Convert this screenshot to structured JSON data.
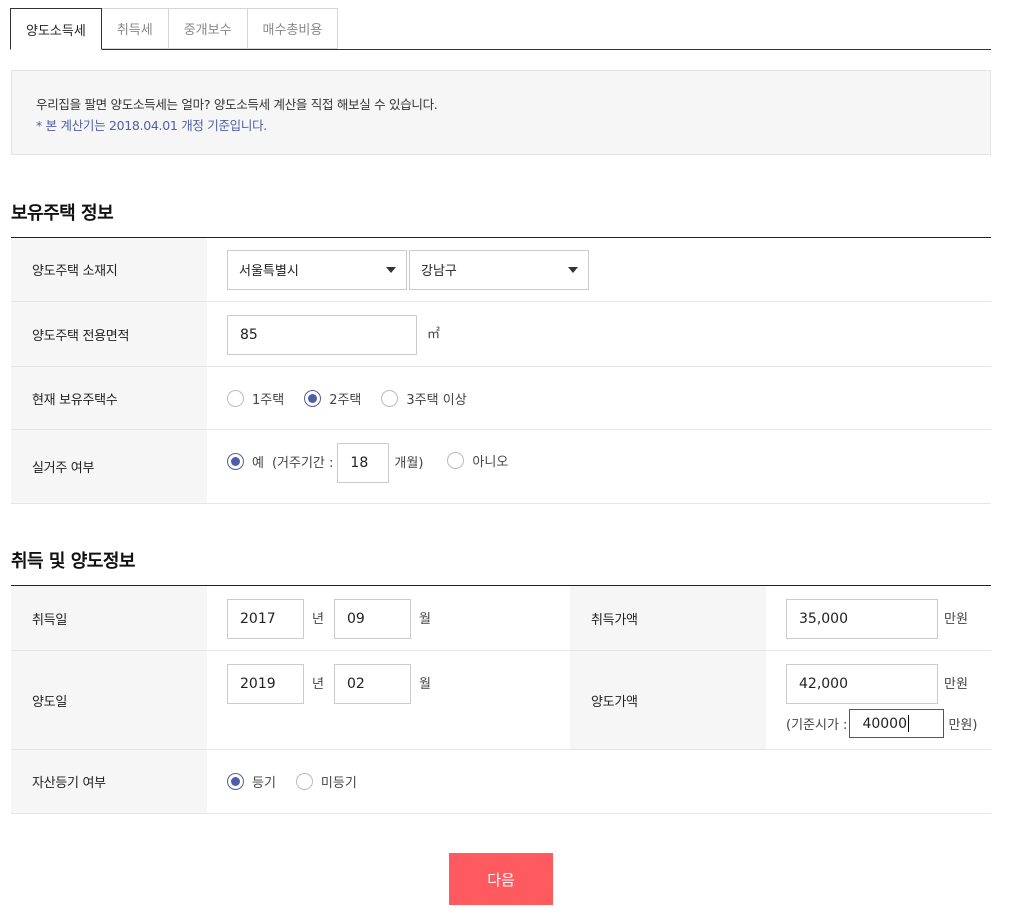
{
  "tabs": [
    {
      "label": "양도소득세",
      "active": true
    },
    {
      "label": "취득세",
      "active": false
    },
    {
      "label": "중개보수",
      "active": false
    },
    {
      "label": "매수총비용",
      "active": false
    }
  ],
  "notice": {
    "line1": "우리집을 팔면 양도소득세는 얼마? 양도소득세 계산을 직접 해보실 수 있습니다.",
    "line2": "* 본 계산기는 2018.04.01 개정 기준입니다."
  },
  "section1": {
    "title": "보유주택 정보",
    "location": {
      "label": "양도주택 소재지",
      "city": "서울특별시",
      "district": "강남구"
    },
    "area": {
      "label": "양도주택 전용면적",
      "value": "85",
      "unit": "㎡"
    },
    "house_count": {
      "label": "현재 보유주택수",
      "options": [
        "1주택",
        "2주택",
        "3주택 이상"
      ],
      "selected": "2주택"
    },
    "residence": {
      "label": "실거주 여부",
      "yes_label": "예",
      "period_prefix": "(거주기간 :",
      "period_value": "18",
      "period_suffix": "개월)",
      "no_label": "아니오",
      "selected": "예"
    }
  },
  "section2": {
    "title": "취득 및 양도정보",
    "acquisition_date": {
      "label": "취득일",
      "year": "2017",
      "year_unit": "년",
      "month": "09",
      "month_unit": "월"
    },
    "acquisition_price": {
      "label": "취득가액",
      "value": "35,000",
      "unit": "만원"
    },
    "transfer_date": {
      "label": "양도일",
      "year": "2019",
      "year_unit": "년",
      "month": "02",
      "month_unit": "월"
    },
    "transfer_price": {
      "label": "양도가액",
      "value": "42,000",
      "unit": "만원",
      "standard_prefix": "(기준시가 :",
      "standard_value": "40000",
      "standard_suffix": "만원)"
    },
    "registration": {
      "label": "자산등기 여부",
      "options": [
        "등기",
        "미등기"
      ],
      "selected": "등기"
    }
  },
  "next_button": "다음",
  "colors": {
    "accent_blue": "#4f5ea8",
    "button_red": "#ff5a5f"
  }
}
